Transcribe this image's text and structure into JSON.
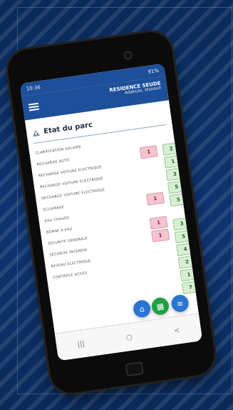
{
  "status_bar": {
    "time": "10:36",
    "right": "91%"
  },
  "app": {
    "title": "RESIDENCE SEUDE",
    "subtitle": "Adabulo, stsnauh"
  },
  "section": {
    "title": "Etat du parc"
  },
  "list": {
    "items": [
      "CLARIFICATION SOLAIRE",
      "RECHARGE AUTO",
      "RECHARGE VOITURE ELECTRIQUE",
      "RECHARGE VOITURE ELECTRIQUE",
      "RECHARGE VOITURE ELECTRIQUE",
      "ECLAIRAGE",
      "EAU CHAUDE",
      "BORNE A EAU",
      "SECURITE GENERALE",
      "SECURITE INCENDIE",
      "RESEAU ELECTRIQUE",
      "CONTROLE ACCES"
    ]
  },
  "badges": {
    "pink": [
      "1",
      "1",
      "1",
      "1"
    ],
    "green": [
      "2",
      "1",
      "3",
      "5",
      "5",
      "3",
      "5",
      "4",
      "2",
      "1",
      "7"
    ]
  },
  "fabs": {
    "home_icon": "home-icon",
    "list_icon": "list-icon",
    "menu_icon": "menu-icon"
  },
  "android_nav": {
    "back": "<",
    "home": "○",
    "recent": "|||"
  }
}
